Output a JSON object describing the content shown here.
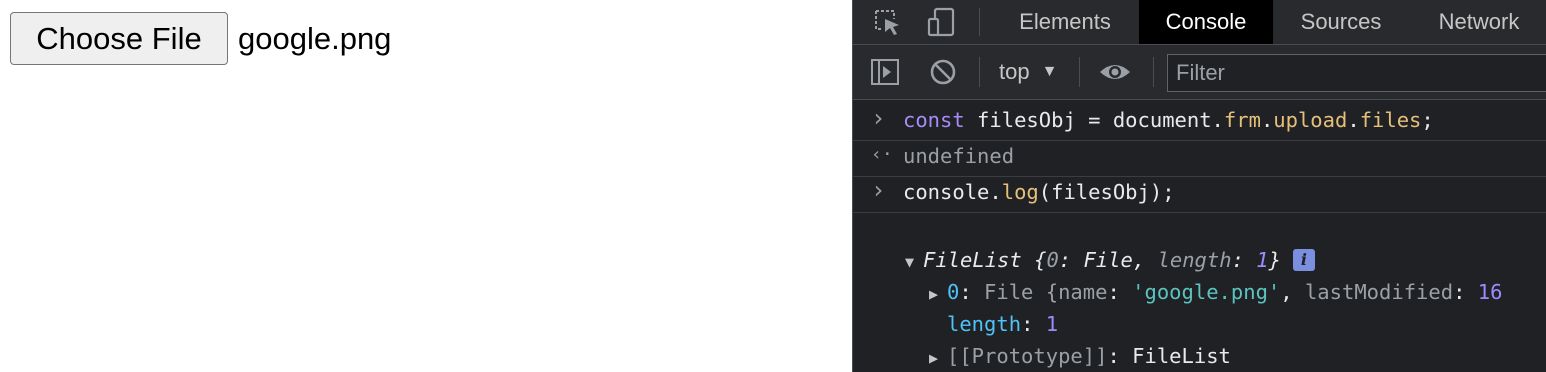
{
  "page": {
    "choose_file_label": "Choose File",
    "file_name": "google.png"
  },
  "devtools": {
    "tabs": [
      "Elements",
      "Console",
      "Sources",
      "Network"
    ],
    "active_tab": "Console",
    "context": "top",
    "filter_placeholder": "Filter",
    "colors": {
      "background": "#202124",
      "toolbar": "#292a2d",
      "active_tab": "#000000"
    }
  },
  "console": {
    "lines": [
      {
        "type": "input",
        "parts": [
          {
            "t": "const",
            "c": "kw"
          },
          {
            "t": " filesObj = document.",
            "c": "ident"
          },
          {
            "t": "frm",
            "c": "prop"
          },
          {
            "t": ".",
            "c": "ident"
          },
          {
            "t": "upload",
            "c": "prop"
          },
          {
            "t": ".",
            "c": "ident"
          },
          {
            "t": "files",
            "c": "prop"
          },
          {
            "t": ";",
            "c": "ident"
          }
        ]
      },
      {
        "type": "result",
        "text": "undefined"
      },
      {
        "type": "input",
        "parts": [
          {
            "t": "console.",
            "c": "ident"
          },
          {
            "t": "log",
            "c": "prop"
          },
          {
            "t": "(filesObj);",
            "c": "ident"
          }
        ]
      }
    ],
    "filelist_header": {
      "name": "FileList",
      "parts": [
        {
          "t": " {",
          "c": "ident italic"
        },
        {
          "t": "0",
          "c": "grey italic"
        },
        {
          "t": ": File, ",
          "c": "ident italic"
        },
        {
          "t": "length",
          "c": "grey italic"
        },
        {
          "t": ": ",
          "c": "ident italic"
        },
        {
          "t": "1",
          "c": "num italic"
        },
        {
          "t": "}",
          "c": "ident italic"
        }
      ],
      "info_badge": "i"
    },
    "filelist_children": [
      {
        "expandable": true,
        "parts": [
          {
            "t": "0",
            "c": "key"
          },
          {
            "t": ": ",
            "c": "ident"
          },
          {
            "t": "File {",
            "c": "grey"
          },
          {
            "t": "name",
            "c": "grey"
          },
          {
            "t": ": ",
            "c": "ident"
          },
          {
            "t": "'google.png'",
            "c": "str"
          },
          {
            "t": ", ",
            "c": "ident"
          },
          {
            "t": "lastModified",
            "c": "grey"
          },
          {
            "t": ": ",
            "c": "ident"
          },
          {
            "t": "16",
            "c": "num"
          }
        ]
      },
      {
        "expandable": false,
        "parts": [
          {
            "t": "length",
            "c": "key"
          },
          {
            "t": ": ",
            "c": "ident"
          },
          {
            "t": "1",
            "c": "num"
          }
        ]
      },
      {
        "expandable": true,
        "parts": [
          {
            "t": "[[Prototype]]",
            "c": "grey"
          },
          {
            "t": ": ",
            "c": "ident"
          },
          {
            "t": "FileList",
            "c": "ident"
          }
        ]
      }
    ]
  }
}
